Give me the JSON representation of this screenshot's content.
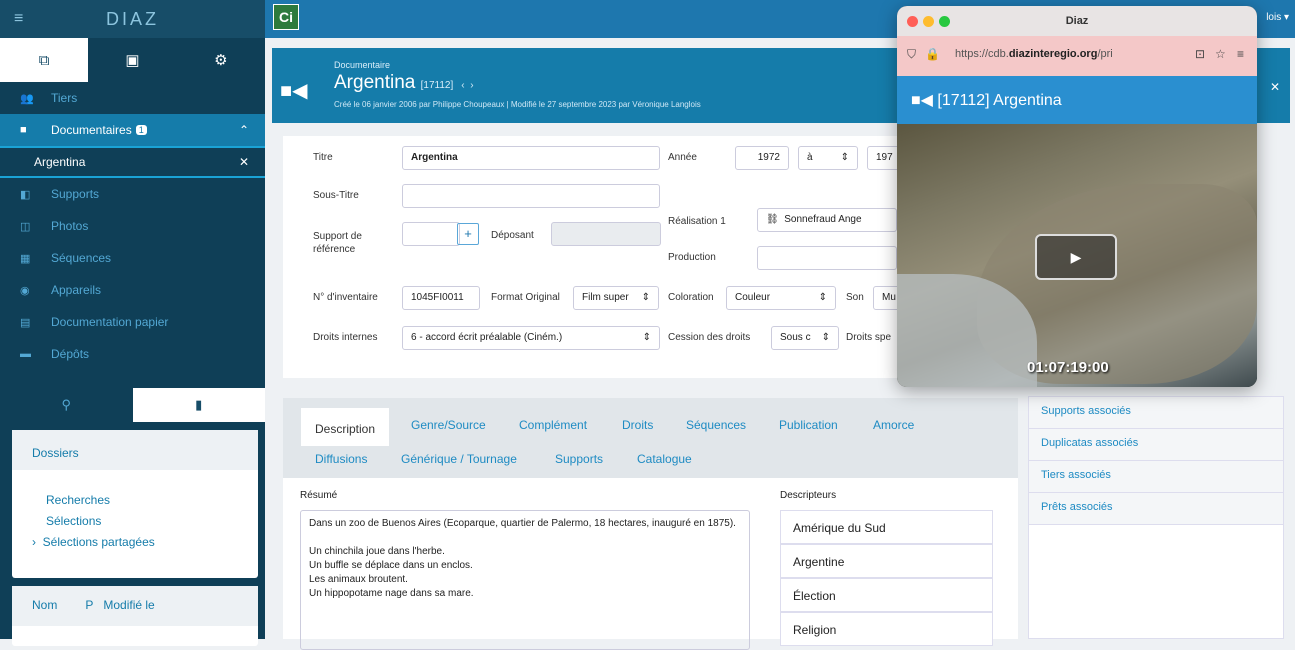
{
  "sidebar": {
    "app_title": "DIAZ",
    "nav": [
      {
        "label": "Tiers",
        "icon": "users-icon"
      },
      {
        "label": "Documentaires",
        "icon": "video-icon",
        "badge": "1"
      },
      {
        "label": "Argentina"
      },
      {
        "label": "Supports",
        "icon": "supports-icon"
      },
      {
        "label": "Photos",
        "icon": "photos-icon"
      },
      {
        "label": "Séquences",
        "icon": "sequences-icon"
      },
      {
        "label": "Appareils",
        "icon": "camera-icon"
      },
      {
        "label": "Documentation papier",
        "icon": "document-icon"
      },
      {
        "label": "Dépôts",
        "icon": "box-icon"
      }
    ],
    "dossiers": {
      "title": "Dossiers",
      "items": [
        "Recherches",
        "Sélections",
        "Sélections partagées"
      ]
    },
    "list_headers": [
      "Nom",
      "P",
      "Modifié le"
    ]
  },
  "topbar": {
    "user": "lois ▾"
  },
  "doc": {
    "type": "Documentaire",
    "title": "Argentina",
    "id": "[17112]",
    "meta": "Créé le 06 janvier 2006 par Philippe Choupeaux | Modifié le 27 septembre 2023 par Véronique Langlois"
  },
  "form": {
    "titre_label": "Titre",
    "titre": "Argentina",
    "annee_label": "Année",
    "annee_from": "1972",
    "a_label": "à",
    "annee_to": "197",
    "soustitre_label": "Sous-Titre",
    "support_label": "Support de référence",
    "deposant_label": "Déposant",
    "realisation_label": "Réalisation 1",
    "realisation": "Sonnefraud Ange",
    "production_label": "Production",
    "inventaire_label": "N° d'inventaire",
    "inventaire": "1045FI0011",
    "format_label": "Format Original",
    "format": "Film super",
    "coloration_label": "Coloration",
    "coloration": "Couleur",
    "son_label": "Son",
    "son": "Mu",
    "droits_label": "Droits internes",
    "droits": "6 - accord écrit préalable (Ciném.)",
    "cession_label": "Cession des droits",
    "cession": "Sous c",
    "droits_spec_label": "Droits spe"
  },
  "tabs": {
    "row1": [
      "Description",
      "Genre/Source",
      "Complément",
      "Droits",
      "Séquences",
      "Publication",
      "Amorce"
    ],
    "row2": [
      "Diffusions",
      "Générique / Tournage",
      "Supports",
      "Catalogue"
    ]
  },
  "description": {
    "resume_label": "Résumé",
    "resume_lines": [
      "Dans un zoo de Buenos Aires (Ecoparque, quartier de Palermo, 18 hectares, inauguré en 1875).",
      "Un chinchila joue dans l'herbe.",
      "Un buffle se déplace dans un enclos.",
      "Les animaux broutent.",
      "Un hippopotame nage dans sa mare."
    ],
    "descripteurs_label": "Descripteurs",
    "descripteurs": [
      "Amérique du Sud",
      "Argentine",
      "Élection",
      "Religion"
    ]
  },
  "right_panel": [
    "Supports associés",
    "Duplicatas associés",
    "Tiers associés",
    "Prêts associés"
  ],
  "popup": {
    "window_title": "Diaz",
    "url_prefix": "https://cdb.",
    "url_domain": "diazinteregio.org",
    "url_suffix": "/pri",
    "heading": "[17112] Argentina",
    "timecode": "01:07:19:00"
  }
}
